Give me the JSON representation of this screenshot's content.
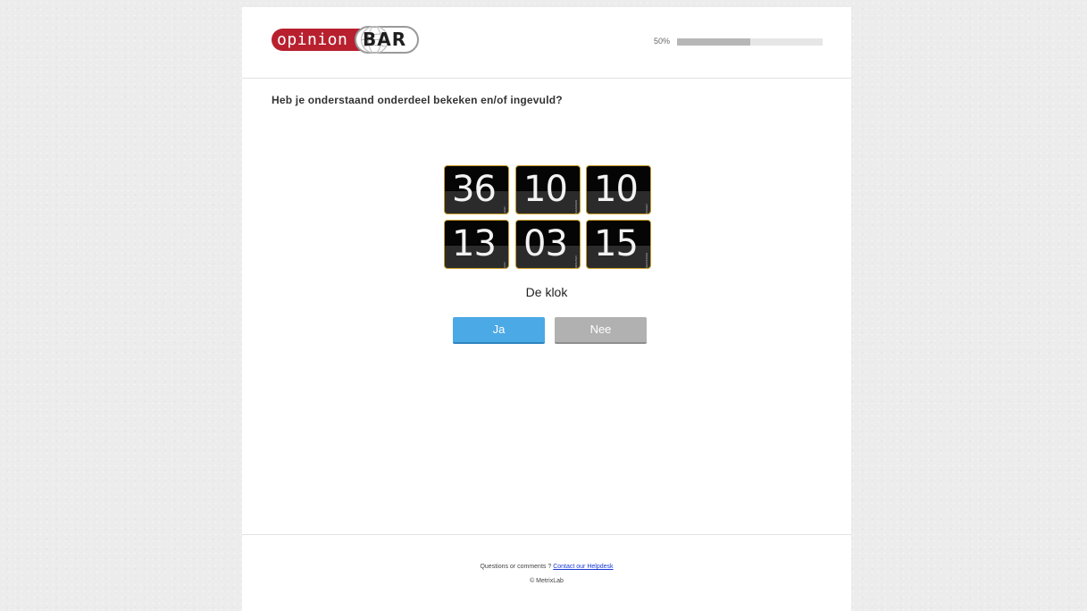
{
  "brand": {
    "logo_left": "opinion",
    "logo_right": "BAR",
    "logo_red": "#b8202e"
  },
  "progress": {
    "label": "50%",
    "value": 0.5
  },
  "question": {
    "text": "Heb je onderstaand onderdeel bekeken en/of ingevuld?"
  },
  "clock": {
    "tiles": [
      {
        "value": "36",
        "unit": "JAAR"
      },
      {
        "value": "10",
        "unit": "MAANDEN"
      },
      {
        "value": "10",
        "unit": "DAGEN"
      },
      {
        "value": "13",
        "unit": "UUR"
      },
      {
        "value": "03",
        "unit": "MINUTEN"
      },
      {
        "value": "15",
        "unit": "SECONDEN"
      }
    ],
    "caption": "De klok",
    "frame_color": "#c79c26"
  },
  "answers": {
    "yes_label": "Ja",
    "no_label": "Nee",
    "yes_color": "#4ba9e5",
    "no_color": "#b1b1b1"
  },
  "footer": {
    "prompt": "Questions or comments ?",
    "link_text": "Contact our Helpdesk",
    "copyright": "© MetrixLab"
  }
}
